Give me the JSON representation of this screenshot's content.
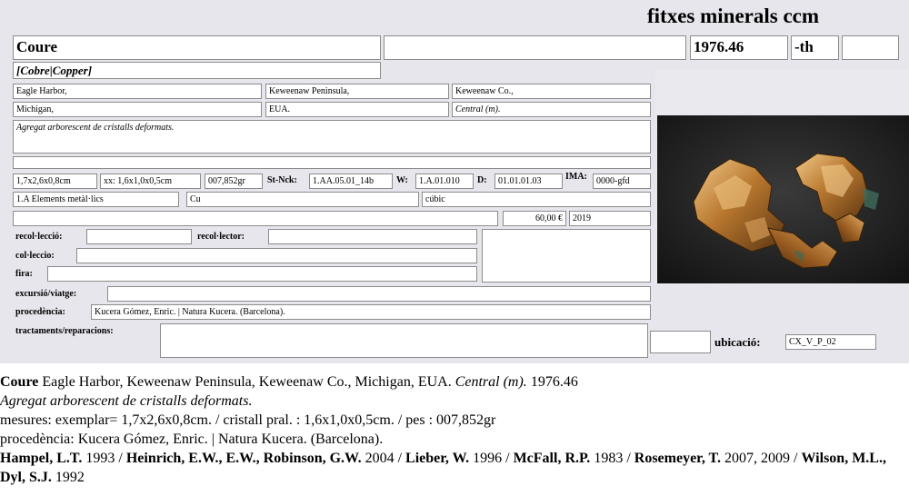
{
  "header": {
    "site_title": "fitxes minerals ccm"
  },
  "card": {
    "name": "Coure",
    "catalog_number": "1976.46",
    "suffix": "-th",
    "synonyms": "[Cobre|Copper]",
    "locality": {
      "place": "Eagle Harbor,",
      "region": "Keweenaw Peninsula,",
      "county": "Keweenaw Co.,",
      "state": "Michigan,",
      "country": "EUA.",
      "zone": "Central (m)."
    },
    "description": "Agregat arborescent de cristalls deformats.",
    "measures": {
      "specimen_size": "1,7x2,6x0,8cm",
      "crystal_size": "xx: 1,6x1,0x0,5cm",
      "weight": "007,852gr"
    },
    "codes": {
      "strunz_label": "St-Nck:",
      "strunz_value": "1.AA.05.01_14b",
      "w_label": "W:",
      "w_value": "1.A.01.010",
      "d_label": "D:",
      "d_value": "01.01.01.03",
      "ima_label": "IMA:",
      "ima_value": "0000-gfd"
    },
    "classification": {
      "class": "1.A Elements metàl·lics",
      "formula": "Cu",
      "system": "cúbic"
    },
    "price": "60,00 €",
    "year": "2019",
    "labels": {
      "recoleccio": "recol·lecció:",
      "recolector": "recol·lector:",
      "colleccio": "col·leccio:",
      "fira": "fira:",
      "excursio": "excursió/viatge:",
      "procedencia": "procedència:",
      "tractaments": "tractaments/reparacions:",
      "ubicacio": "ubicació:"
    },
    "procedencia": "Kucera Gómez, Enric. | Natura Kucera. (Barcelona).",
    "ubicacio": "CX_V_P_02"
  },
  "summary": {
    "name": "Coure",
    "locality_text": " Eagle Harbor, Keweenaw Peninsula, Keweenaw Co., Michigan, EUA. ",
    "zone": "Central (m).",
    "catalog": "  1976.46",
    "description": "Agregat arborescent de cristalls deformats.",
    "measures": "mesures: exemplar= 1,7x2,6x0,8cm. / cristall pral. : 1,6x1,0x0,5cm. / pes : 007,852gr",
    "procedencia": "procedència: Kucera Gómez, Enric. | Natura Kucera. (Barcelona).",
    "references": [
      {
        "author": "Hampel, L.T.",
        "year": " 1993 / "
      },
      {
        "author": "Heinrich, E.W., E.W., Robinson, G.W.",
        "year": " 2004 / "
      },
      {
        "author": "Lieber, W.",
        "year": " 1996 / "
      },
      {
        "author": "McFall, R.P.",
        "year": " 1983 / "
      },
      {
        "author": "Rosemeyer, T.",
        "year": " 2007, 2009 / "
      },
      {
        "author": "Wilson, M.L., Dyl, S.J.",
        "year": " 1992"
      }
    ]
  }
}
